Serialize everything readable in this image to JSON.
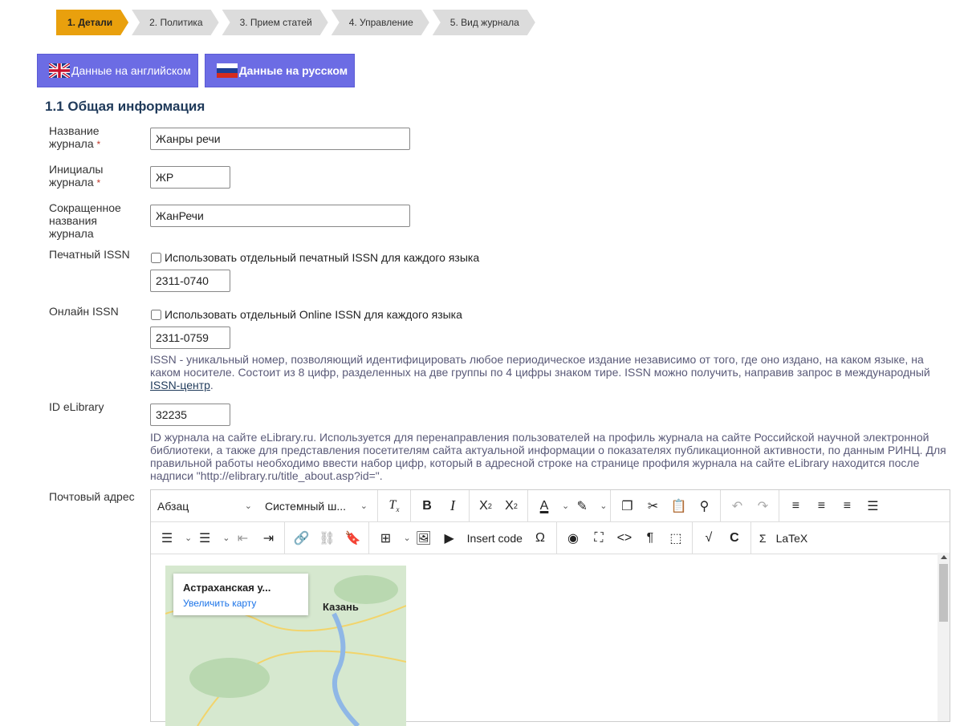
{
  "steps": [
    "1. Детали",
    "2. Политика",
    "3. Прием статей",
    "4. Управление",
    "5. Вид журнала"
  ],
  "lang_tabs": {
    "english": "Данные на английском",
    "russian": "Данные на русском"
  },
  "section_title": "1.1 Общая информация",
  "fields": {
    "title_label_1": "Название",
    "title_label_2": "журнала",
    "title_value": "Жанры речи",
    "initials_label_1": "Инициалы",
    "initials_label_2": "журнала",
    "initials_value": "ЖР",
    "abbr_label_1": "Сокращенное",
    "abbr_label_2": "названия",
    "abbr_label_3": "журнала",
    "abbr_value": "ЖанРечи",
    "print_issn_label": "Печатный ISSN",
    "print_issn_checkbox": "Использовать отдельный печатный ISSN для каждого языка",
    "print_issn_value": "2311-0740",
    "online_issn_label": "Онлайн ISSN",
    "online_issn_checkbox": "Использовать отдельный Online ISSN для каждого языка",
    "online_issn_value": "2311-0759",
    "issn_help": "ISSN - уникальный номер, позволяющий идентифицировать любое периодическое издание независимо от того, где оно издано, на каком языке, на каком носителе. Состоит из 8 цифр, разделенных на две группы по 4 цифры знаком тире. ISSN можно получить, направив запрос в международный",
    "issn_link": "ISSN-центр",
    "issn_help_end": ".",
    "elibrary_label": "ID eLibrary",
    "elibrary_value": "32235",
    "elibrary_help": "ID журнала на сайте eLibrary.ru. Используется для перенаправления пользователей на профиль журнала на сайте Российской научной электронной библиотеки, а также для представления посетителям сайта актуальной информации о показателях публикационной активности, по данным РИНЦ. Для правильной работы необходимо ввести набор цифр, который в адресной строке на странице профиля журнала на сайте eLibrary находится после надписи \"http://elibrary.ru/title_about.asp?id=\".",
    "postal_label": "Почтовый адрес",
    "required_mark": "*"
  },
  "editor": {
    "paragraph": "Абзац",
    "font": "Системный ш...",
    "insert_code": "Insert code",
    "latex": "LaTeX",
    "sigma": "Σ",
    "map_place": "Астраханская у...",
    "map_link": "Увеличить карту",
    "map_city": "Казань"
  },
  "colors": {
    "step_active": "#e9a00d",
    "lang_tab": "#6c6ce4",
    "section_title": "#1f3a5a"
  }
}
